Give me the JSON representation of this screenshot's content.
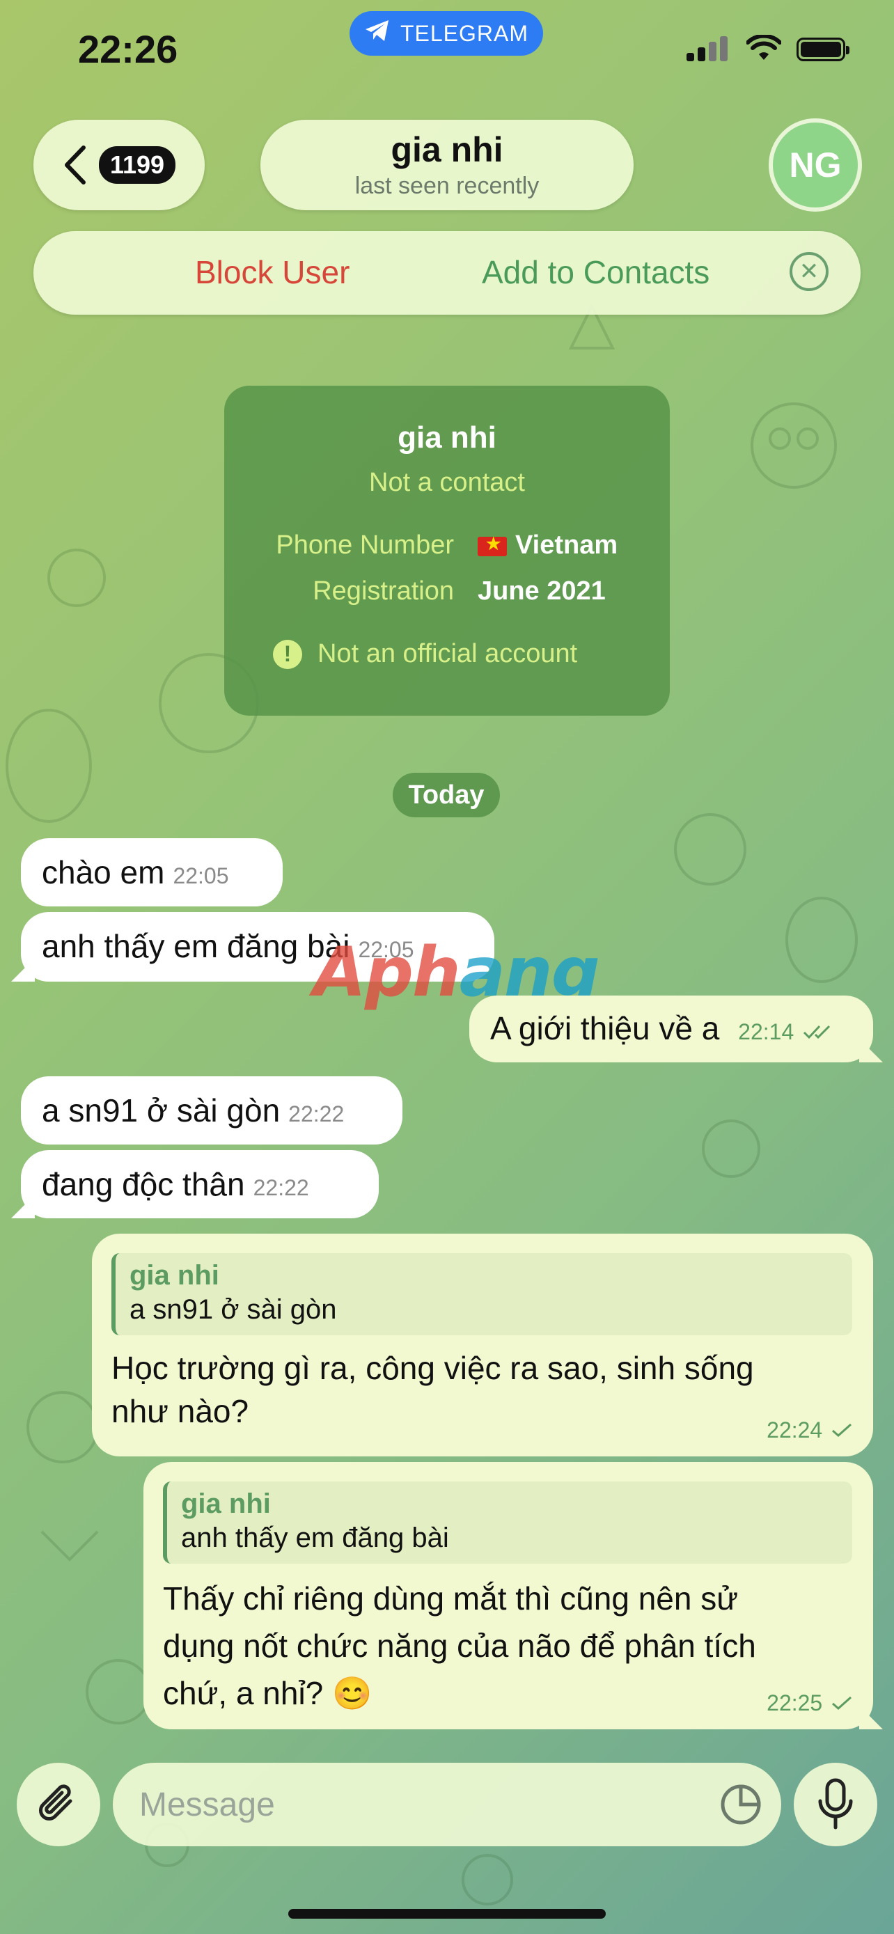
{
  "status_bar": {
    "time": "22:26",
    "app_label": "TELEGRAM"
  },
  "header": {
    "back_count": "1199",
    "contact_name": "gia nhi",
    "last_seen": "last seen recently",
    "avatar_initials": "NG"
  },
  "action_bar": {
    "block_label": "Block User",
    "add_label": "Add to Contacts"
  },
  "info_card": {
    "name": "gia nhi",
    "subtitle": "Not a contact",
    "phone_label": "Phone Number",
    "phone_value": "Vietnam",
    "registration_label": "Registration",
    "registration_value": "June 2021",
    "warning": "Not an official account"
  },
  "date_separator": "Today",
  "messages": [
    {
      "direction": "in",
      "text": "chào em",
      "time": "22:05"
    },
    {
      "direction": "in",
      "text": "anh thấy em đăng bài",
      "time": "22:05"
    },
    {
      "direction": "out",
      "text": "A giới thiệu về a",
      "time": "22:14"
    },
    {
      "direction": "in",
      "text": "a sn91 ở sài gòn",
      "time": "22:22"
    },
    {
      "direction": "in",
      "text": "đang độc thân",
      "time": "22:22"
    },
    {
      "direction": "out",
      "reply_name": "gia nhi",
      "reply_text": "a sn91 ở sài gòn",
      "line1": "Học trường gì ra, công việc ra sao, sinh sống",
      "line2": "như nào?",
      "time": "22:24"
    },
    {
      "direction": "out",
      "reply_name": "gia nhi",
      "reply_text": "anh thấy em đăng bài",
      "line1": "Thấy chỉ riêng dùng mắt thì cũng nên sử",
      "line2": "dụng nốt chức năng của não để phân tích",
      "line3": "chứ, a nhỉ? 😊",
      "time": "22:25"
    }
  ],
  "watermark": {
    "part1": "Aph",
    "part2": "ang"
  },
  "composer": {
    "placeholder": "Message"
  },
  "colors": {
    "accent_green": "#5c9c63",
    "block_red": "#d6473a",
    "telegram_blue": "#2e7cf3"
  },
  "icons": [
    "telegram-icon",
    "back-chevron-icon",
    "close-icon",
    "warning-icon",
    "double-check-icon",
    "check-icon",
    "paperclip-icon",
    "sticker-icon",
    "microphone-icon"
  ]
}
